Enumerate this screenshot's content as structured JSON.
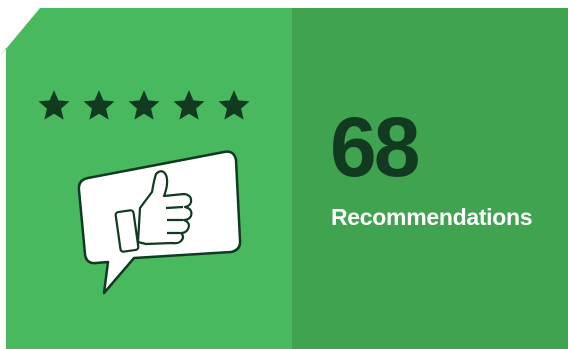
{
  "card": {
    "rating_stars": 5,
    "rating_out_of": 5,
    "recommendation_count": "68",
    "recommendation_label": "Recommendations"
  },
  "colors": {
    "left_panel": "#48b95e",
    "right_panel": "#3fa34f",
    "count_text": "#123a20",
    "stars": "#123a20",
    "bubble_fill": "#ffffff",
    "bubble_outline": "#123a20"
  },
  "icons": {
    "stars": "star-icon",
    "bubble": "speech-bubble-icon",
    "thumb": "thumbs-up-icon"
  }
}
